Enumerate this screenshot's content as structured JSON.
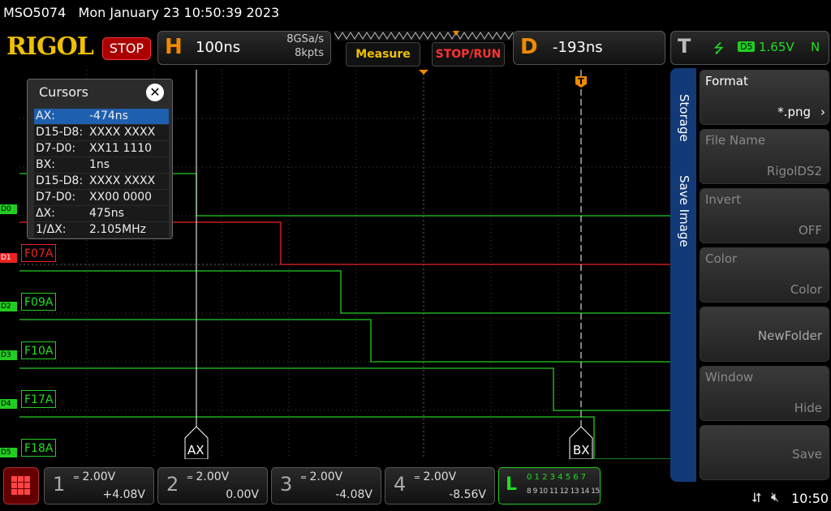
{
  "status": {
    "model": "MSO5074",
    "datetime": "Mon January 23 10:50:39 2023"
  },
  "toolbar": {
    "brand": "RIGOL",
    "run_state": "STOP",
    "horizontal": {
      "letter": "H",
      "timebase": "100ns",
      "sample_rate": "8GSa/s",
      "memory_depth": "8kpts"
    },
    "measure_label": "Measure",
    "stoprun_label": "STOP/RUN",
    "delay": {
      "letter": "D",
      "value": "-193ns"
    },
    "trigger": {
      "letter": "T",
      "source": "D5",
      "level": "1.65V",
      "mode": "N"
    }
  },
  "cursors_panel": {
    "title": "Cursors",
    "close": "✕",
    "rows": [
      {
        "k": "AX:",
        "v": "-474ns"
      },
      {
        "k": "D15-D8:",
        "v": "XXXX XXXX"
      },
      {
        "k": "D7-D0:",
        "v": "XX11 1110"
      },
      {
        "k": "BX:",
        "v": "1ns"
      },
      {
        "k": "D15-D8:",
        "v": "XXXX XXXX"
      },
      {
        "k": "D7-D0:",
        "v": "XX00 0000"
      },
      {
        "k": "ΔX:",
        "v": "475ns"
      },
      {
        "k": "1/ΔX:",
        "v": "2.105MHz"
      }
    ]
  },
  "channels": [
    {
      "mark": "D0",
      "label": "",
      "color": "#22cc22"
    },
    {
      "mark": "D1",
      "label": "F07A",
      "color": "#ee2222"
    },
    {
      "mark": "D2",
      "label": "F09A",
      "color": "#22cc22"
    },
    {
      "mark": "D3",
      "label": "F10A",
      "color": "#22cc22"
    },
    {
      "mark": "D4",
      "label": "F17A",
      "color": "#22cc22"
    },
    {
      "mark": "D5",
      "label": "F18A",
      "color": "#22cc22"
    }
  ],
  "cursor_labels": {
    "a": "AX",
    "b": "BX"
  },
  "menu": {
    "tabs": [
      "Storage",
      "Save Image"
    ],
    "items": [
      {
        "title": "Format",
        "value": "*.png"
      },
      {
        "title": "File Name",
        "value": "RigolDS2"
      },
      {
        "title": "Invert",
        "value": "OFF"
      },
      {
        "title": "Color",
        "value": "Color"
      },
      {
        "title": "",
        "value": "NewFolder"
      },
      {
        "title": "Window",
        "value": "Hide"
      },
      {
        "title": "",
        "value": "Save"
      }
    ]
  },
  "bottom": {
    "ch": [
      {
        "n": "1",
        "scale": "2.00V",
        "offset": "+4.08V"
      },
      {
        "n": "2",
        "scale": "2.00V",
        "offset": "0.00V"
      },
      {
        "n": "3",
        "scale": "2.00V",
        "offset": "-4.08V"
      },
      {
        "n": "4",
        "scale": "2.00V",
        "offset": "-8.56V"
      }
    ],
    "la": {
      "letter": "L",
      "row1": "0 1 2 3 4 5 6 7",
      "row2": "8 9 10 11 12 13 14 15"
    },
    "clock": "10:50"
  },
  "colors": {
    "accent": "#f08a00",
    "menu_tab": "#123a78",
    "digital": "#22cc22",
    "d1": "#ee2222"
  }
}
